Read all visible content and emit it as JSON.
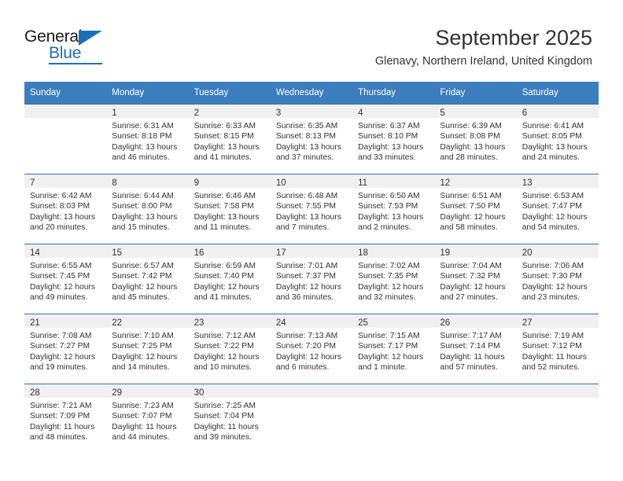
{
  "brand": {
    "name_dark": "General",
    "name_blue": "Blue",
    "accent_color": "#1d70b7"
  },
  "header": {
    "month_title": "September 2025",
    "location": "Glenavy, Northern Ireland, United Kingdom",
    "header_bg_color": "#3c7ebd",
    "row_border_color": "#2f72b0",
    "daynum_band_color": "#f0f0f0"
  },
  "weekday_headers": [
    "Sunday",
    "Monday",
    "Tuesday",
    "Wednesday",
    "Thursday",
    "Friday",
    "Saturday"
  ],
  "weeks": [
    [
      {
        "day": "",
        "sunrise": "",
        "sunset": "",
        "daylight_line1": "",
        "daylight_line2": "",
        "empty": true
      },
      {
        "day": "1",
        "sunrise": "Sunrise: 6:31 AM",
        "sunset": "Sunset: 8:18 PM",
        "daylight_line1": "Daylight: 13 hours",
        "daylight_line2": "and 46 minutes."
      },
      {
        "day": "2",
        "sunrise": "Sunrise: 6:33 AM",
        "sunset": "Sunset: 8:15 PM",
        "daylight_line1": "Daylight: 13 hours",
        "daylight_line2": "and 41 minutes."
      },
      {
        "day": "3",
        "sunrise": "Sunrise: 6:35 AM",
        "sunset": "Sunset: 8:13 PM",
        "daylight_line1": "Daylight: 13 hours",
        "daylight_line2": "and 37 minutes."
      },
      {
        "day": "4",
        "sunrise": "Sunrise: 6:37 AM",
        "sunset": "Sunset: 8:10 PM",
        "daylight_line1": "Daylight: 13 hours",
        "daylight_line2": "and 33 minutes."
      },
      {
        "day": "5",
        "sunrise": "Sunrise: 6:39 AM",
        "sunset": "Sunset: 8:08 PM",
        "daylight_line1": "Daylight: 13 hours",
        "daylight_line2": "and 28 minutes."
      },
      {
        "day": "6",
        "sunrise": "Sunrise: 6:41 AM",
        "sunset": "Sunset: 8:05 PM",
        "daylight_line1": "Daylight: 13 hours",
        "daylight_line2": "and 24 minutes."
      }
    ],
    [
      {
        "day": "7",
        "sunrise": "Sunrise: 6:42 AM",
        "sunset": "Sunset: 8:03 PM",
        "daylight_line1": "Daylight: 13 hours",
        "daylight_line2": "and 20 minutes."
      },
      {
        "day": "8",
        "sunrise": "Sunrise: 6:44 AM",
        "sunset": "Sunset: 8:00 PM",
        "daylight_line1": "Daylight: 13 hours",
        "daylight_line2": "and 15 minutes."
      },
      {
        "day": "9",
        "sunrise": "Sunrise: 6:46 AM",
        "sunset": "Sunset: 7:58 PM",
        "daylight_line1": "Daylight: 13 hours",
        "daylight_line2": "and 11 minutes."
      },
      {
        "day": "10",
        "sunrise": "Sunrise: 6:48 AM",
        "sunset": "Sunset: 7:55 PM",
        "daylight_line1": "Daylight: 13 hours",
        "daylight_line2": "and 7 minutes."
      },
      {
        "day": "11",
        "sunrise": "Sunrise: 6:50 AM",
        "sunset": "Sunset: 7:53 PM",
        "daylight_line1": "Daylight: 13 hours",
        "daylight_line2": "and 2 minutes."
      },
      {
        "day": "12",
        "sunrise": "Sunrise: 6:51 AM",
        "sunset": "Sunset: 7:50 PM",
        "daylight_line1": "Daylight: 12 hours",
        "daylight_line2": "and 58 minutes."
      },
      {
        "day": "13",
        "sunrise": "Sunrise: 6:53 AM",
        "sunset": "Sunset: 7:47 PM",
        "daylight_line1": "Daylight: 12 hours",
        "daylight_line2": "and 54 minutes."
      }
    ],
    [
      {
        "day": "14",
        "sunrise": "Sunrise: 6:55 AM",
        "sunset": "Sunset: 7:45 PM",
        "daylight_line1": "Daylight: 12 hours",
        "daylight_line2": "and 49 minutes."
      },
      {
        "day": "15",
        "sunrise": "Sunrise: 6:57 AM",
        "sunset": "Sunset: 7:42 PM",
        "daylight_line1": "Daylight: 12 hours",
        "daylight_line2": "and 45 minutes."
      },
      {
        "day": "16",
        "sunrise": "Sunrise: 6:59 AM",
        "sunset": "Sunset: 7:40 PM",
        "daylight_line1": "Daylight: 12 hours",
        "daylight_line2": "and 41 minutes."
      },
      {
        "day": "17",
        "sunrise": "Sunrise: 7:01 AM",
        "sunset": "Sunset: 7:37 PM",
        "daylight_line1": "Daylight: 12 hours",
        "daylight_line2": "and 36 minutes."
      },
      {
        "day": "18",
        "sunrise": "Sunrise: 7:02 AM",
        "sunset": "Sunset: 7:35 PM",
        "daylight_line1": "Daylight: 12 hours",
        "daylight_line2": "and 32 minutes."
      },
      {
        "day": "19",
        "sunrise": "Sunrise: 7:04 AM",
        "sunset": "Sunset: 7:32 PM",
        "daylight_line1": "Daylight: 12 hours",
        "daylight_line2": "and 27 minutes."
      },
      {
        "day": "20",
        "sunrise": "Sunrise: 7:06 AM",
        "sunset": "Sunset: 7:30 PM",
        "daylight_line1": "Daylight: 12 hours",
        "daylight_line2": "and 23 minutes."
      }
    ],
    [
      {
        "day": "21",
        "sunrise": "Sunrise: 7:08 AM",
        "sunset": "Sunset: 7:27 PM",
        "daylight_line1": "Daylight: 12 hours",
        "daylight_line2": "and 19 minutes."
      },
      {
        "day": "22",
        "sunrise": "Sunrise: 7:10 AM",
        "sunset": "Sunset: 7:25 PM",
        "daylight_line1": "Daylight: 12 hours",
        "daylight_line2": "and 14 minutes."
      },
      {
        "day": "23",
        "sunrise": "Sunrise: 7:12 AM",
        "sunset": "Sunset: 7:22 PM",
        "daylight_line1": "Daylight: 12 hours",
        "daylight_line2": "and 10 minutes."
      },
      {
        "day": "24",
        "sunrise": "Sunrise: 7:13 AM",
        "sunset": "Sunset: 7:20 PM",
        "daylight_line1": "Daylight: 12 hours",
        "daylight_line2": "and 6 minutes."
      },
      {
        "day": "25",
        "sunrise": "Sunrise: 7:15 AM",
        "sunset": "Sunset: 7:17 PM",
        "daylight_line1": "Daylight: 12 hours",
        "daylight_line2": "and 1 minute."
      },
      {
        "day": "26",
        "sunrise": "Sunrise: 7:17 AM",
        "sunset": "Sunset: 7:14 PM",
        "daylight_line1": "Daylight: 11 hours",
        "daylight_line2": "and 57 minutes."
      },
      {
        "day": "27",
        "sunrise": "Sunrise: 7:19 AM",
        "sunset": "Sunset: 7:12 PM",
        "daylight_line1": "Daylight: 11 hours",
        "daylight_line2": "and 52 minutes."
      }
    ],
    [
      {
        "day": "28",
        "sunrise": "Sunrise: 7:21 AM",
        "sunset": "Sunset: 7:09 PM",
        "daylight_line1": "Daylight: 11 hours",
        "daylight_line2": "and 48 minutes."
      },
      {
        "day": "29",
        "sunrise": "Sunrise: 7:23 AM",
        "sunset": "Sunset: 7:07 PM",
        "daylight_line1": "Daylight: 11 hours",
        "daylight_line2": "and 44 minutes."
      },
      {
        "day": "30",
        "sunrise": "Sunrise: 7:25 AM",
        "sunset": "Sunset: 7:04 PM",
        "daylight_line1": "Daylight: 11 hours",
        "daylight_line2": "and 39 minutes."
      },
      {
        "day": "",
        "sunrise": "",
        "sunset": "",
        "daylight_line1": "",
        "daylight_line2": "",
        "empty": true
      },
      {
        "day": "",
        "sunrise": "",
        "sunset": "",
        "daylight_line1": "",
        "daylight_line2": "",
        "empty": true
      },
      {
        "day": "",
        "sunrise": "",
        "sunset": "",
        "daylight_line1": "",
        "daylight_line2": "",
        "empty": true
      },
      {
        "day": "",
        "sunrise": "",
        "sunset": "",
        "daylight_line1": "",
        "daylight_line2": "",
        "empty": true
      }
    ]
  ]
}
